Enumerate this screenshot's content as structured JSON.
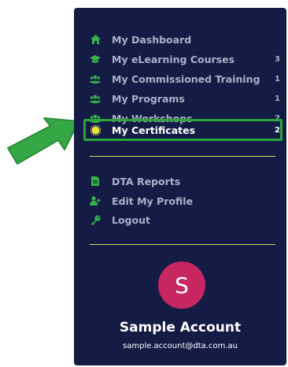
{
  "menu": {
    "items": [
      {
        "label": "My Dashboard",
        "icon": "home-icon",
        "count": ""
      },
      {
        "label": "My eLearning Courses",
        "icon": "graduation-cap-icon",
        "count": "3"
      },
      {
        "label": "My Commissioned Training",
        "icon": "users-icon",
        "count": "1"
      },
      {
        "label": "My Programs",
        "icon": "users-icon",
        "count": "1"
      },
      {
        "label": "My Workshops",
        "icon": "users-icon",
        "count": "2"
      },
      {
        "label": "My Certificates",
        "icon": "certificate-icon",
        "count": "2",
        "active": true
      }
    ],
    "secondary": [
      {
        "label": "DTA Reports",
        "icon": "file-icon"
      },
      {
        "label": "Edit My Profile",
        "icon": "user-plus-icon"
      },
      {
        "label": "Logout",
        "icon": "key-icon"
      }
    ]
  },
  "account": {
    "initial": "S",
    "name": "Sample Account",
    "email": "sample.account@dta.com.au"
  },
  "colors": {
    "panel_bg": "#141c45",
    "icon": "#36b24a",
    "highlight": "#2aa63b",
    "divider": "#cfd86a",
    "avatar": "#c72661"
  }
}
